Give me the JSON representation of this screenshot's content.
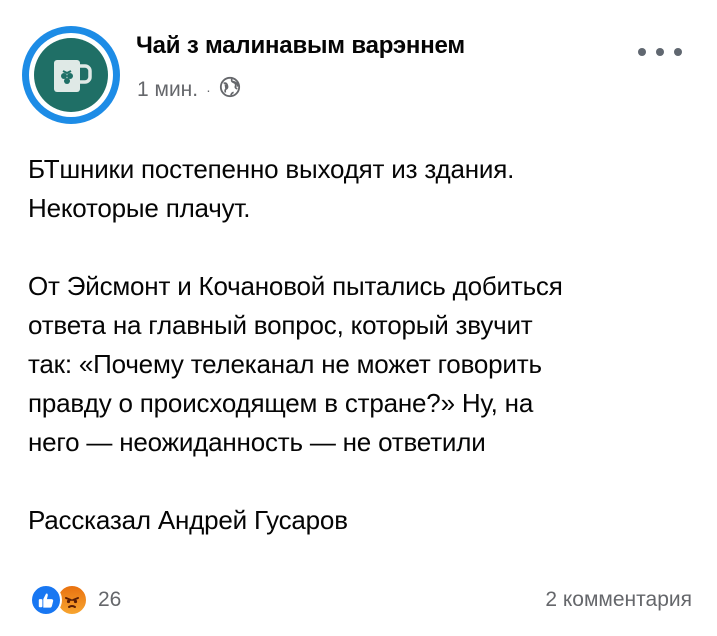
{
  "post": {
    "page_name": "Чай з малинавым варэннем",
    "timestamp": "1 мин.",
    "separator": "·",
    "privacy_icon": "globe-icon",
    "more_icon": "more-horizontal-icon",
    "body_paragraphs": [
      "БТшники постепенно выходят из здания.\nНекоторые плачут.",
      "От Эйсмонт и Кочановой пытались добиться\nответа на главный вопрос, который звучит\nтак: «Почему телеканал не может говорить\nправду о происходящем в стране?» Ну, на\nнего — неожиданность — не ответили",
      "Рассказал Андрей Гусаров"
    ],
    "reactions": {
      "icons": [
        "like-icon",
        "angry-icon"
      ],
      "count": "26"
    },
    "comments_label": "2 комментария"
  },
  "colors": {
    "avatar_ring": "#1d8ce6",
    "avatar_bg": "#1f6f66",
    "like_blue": "#1877f2",
    "angry_orange": "#e9710f",
    "secondary_text": "#65676b"
  }
}
